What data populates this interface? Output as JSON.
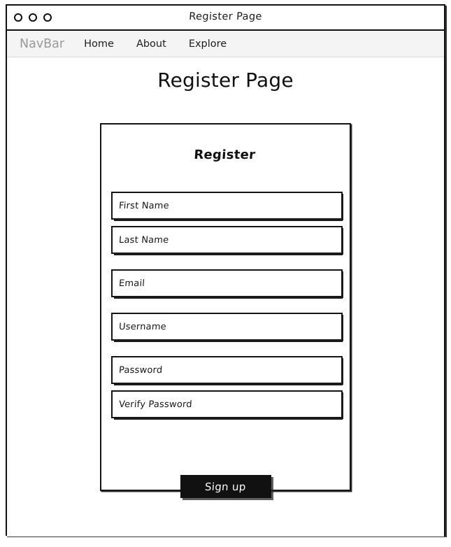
{
  "window": {
    "title": "Register Page",
    "controls": [
      {
        "name": "window-control-close"
      },
      {
        "name": "window-control-minimize"
      },
      {
        "name": "window-control-maximize"
      }
    ]
  },
  "navbar": {
    "brand": "NavBar",
    "links": [
      {
        "label": "Home"
      },
      {
        "label": "About"
      },
      {
        "label": "Explore"
      }
    ],
    "background_color": "#f4f4f4",
    "brand_color": "#9a9a9a",
    "link_color": "#1d1d1d"
  },
  "page": {
    "heading": "Register Page"
  },
  "form": {
    "title": "Register",
    "fields": [
      {
        "label": "First Name",
        "value": "",
        "type": "text",
        "name": "first-name-input"
      },
      {
        "label": "Last Name",
        "value": "",
        "type": "text",
        "name": "last-name-input"
      },
      {
        "label": "Email",
        "value": "",
        "type": "email",
        "name": "email-input"
      },
      {
        "label": "Username",
        "value": "",
        "type": "text",
        "name": "username-input"
      },
      {
        "label": "Password",
        "value": "",
        "type": "password",
        "name": "password-input"
      },
      {
        "label": "Verify Password",
        "value": "",
        "type": "password",
        "name": "verify-password-input"
      }
    ],
    "submit_label": "Sign up",
    "submit_bg_color": "#111111",
    "submit_text_color": "#ffffff"
  }
}
